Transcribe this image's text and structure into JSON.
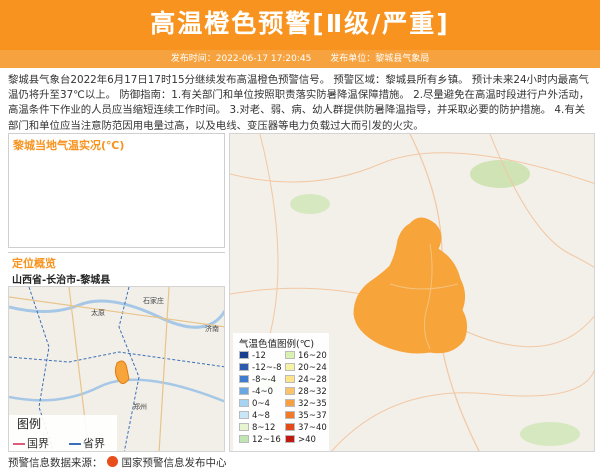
{
  "header": {
    "title": "高温橙色预警[Ⅱ级/严重]",
    "publish_time": "发布时间：2022-06-17 17:20:45",
    "publish_unit": "发布单位：黎城县气象局"
  },
  "body_text": "黎城县气象台2022年6月17日17时15分继续发布高温橙色预警信号。 预警区域：黎城县所有乡镇。 预计未来24小时内最高气温仍将升至37℃以上。 防御指南：1.有关部门和单位按照职责落实防暑降温保障措施。 2.尽量避免在高温时段进行户外活动，高温条件下作业的人员应当缩短连续工作时间。 3.对老、弱、病、幼人群提供防暑降温指导，并采取必要的防护措施。 4.有关部门和单位应当注意防范因用电量过高，以及电线、变压器等电力负载过大而引发的火灾。",
  "temp_panel": {
    "title": "黎城当地气温实况(℃)"
  },
  "location_panel": {
    "title": "定位概览",
    "path": "山西省-长治市-黎城县",
    "map_labels": [
      "太原",
      "石家庄",
      "济南",
      "郑州"
    ],
    "legend": {
      "title": "图例",
      "items": [
        {
          "label": "国界",
          "color": "#e05a7a"
        },
        {
          "label": "省界",
          "color": "#3a6fb8"
        }
      ]
    }
  },
  "temp_legend": {
    "title": "气温色值图例(℃)",
    "items": [
      {
        "label": "-12",
        "color": "#1a3f8f"
      },
      {
        "label": "16~20",
        "color": "#d9f2b4"
      },
      {
        "label": "-12~-8",
        "color": "#2c5bb0"
      },
      {
        "label": "20~24",
        "color": "#f7f3a6"
      },
      {
        "label": "-8~-4",
        "color": "#3f7cd0"
      },
      {
        "label": "24~28",
        "color": "#fde48a"
      },
      {
        "label": "-4~0",
        "color": "#6aa6e2"
      },
      {
        "label": "28~32",
        "color": "#fbc46b"
      },
      {
        "label": "0~4",
        "color": "#a7d3f2"
      },
      {
        "label": "32~35",
        "color": "#f7a043"
      },
      {
        "label": "4~8",
        "color": "#c9e8f7"
      },
      {
        "label": "35~37",
        "color": "#f07a27"
      },
      {
        "label": "8~12",
        "color": "#e6f5d0"
      },
      {
        "label": "37~40",
        "color": "#e24a1a"
      },
      {
        "label": "12~16",
        "color": "#bfe6b0"
      },
      {
        "label": ">40",
        "color": "#c01a10"
      }
    ]
  },
  "footer": {
    "label": "预警信息数据来源：",
    "org": "国家预警信息发布中心"
  },
  "colors": {
    "accent": "#f7931e",
    "warning_area": "#f7a43a"
  }
}
